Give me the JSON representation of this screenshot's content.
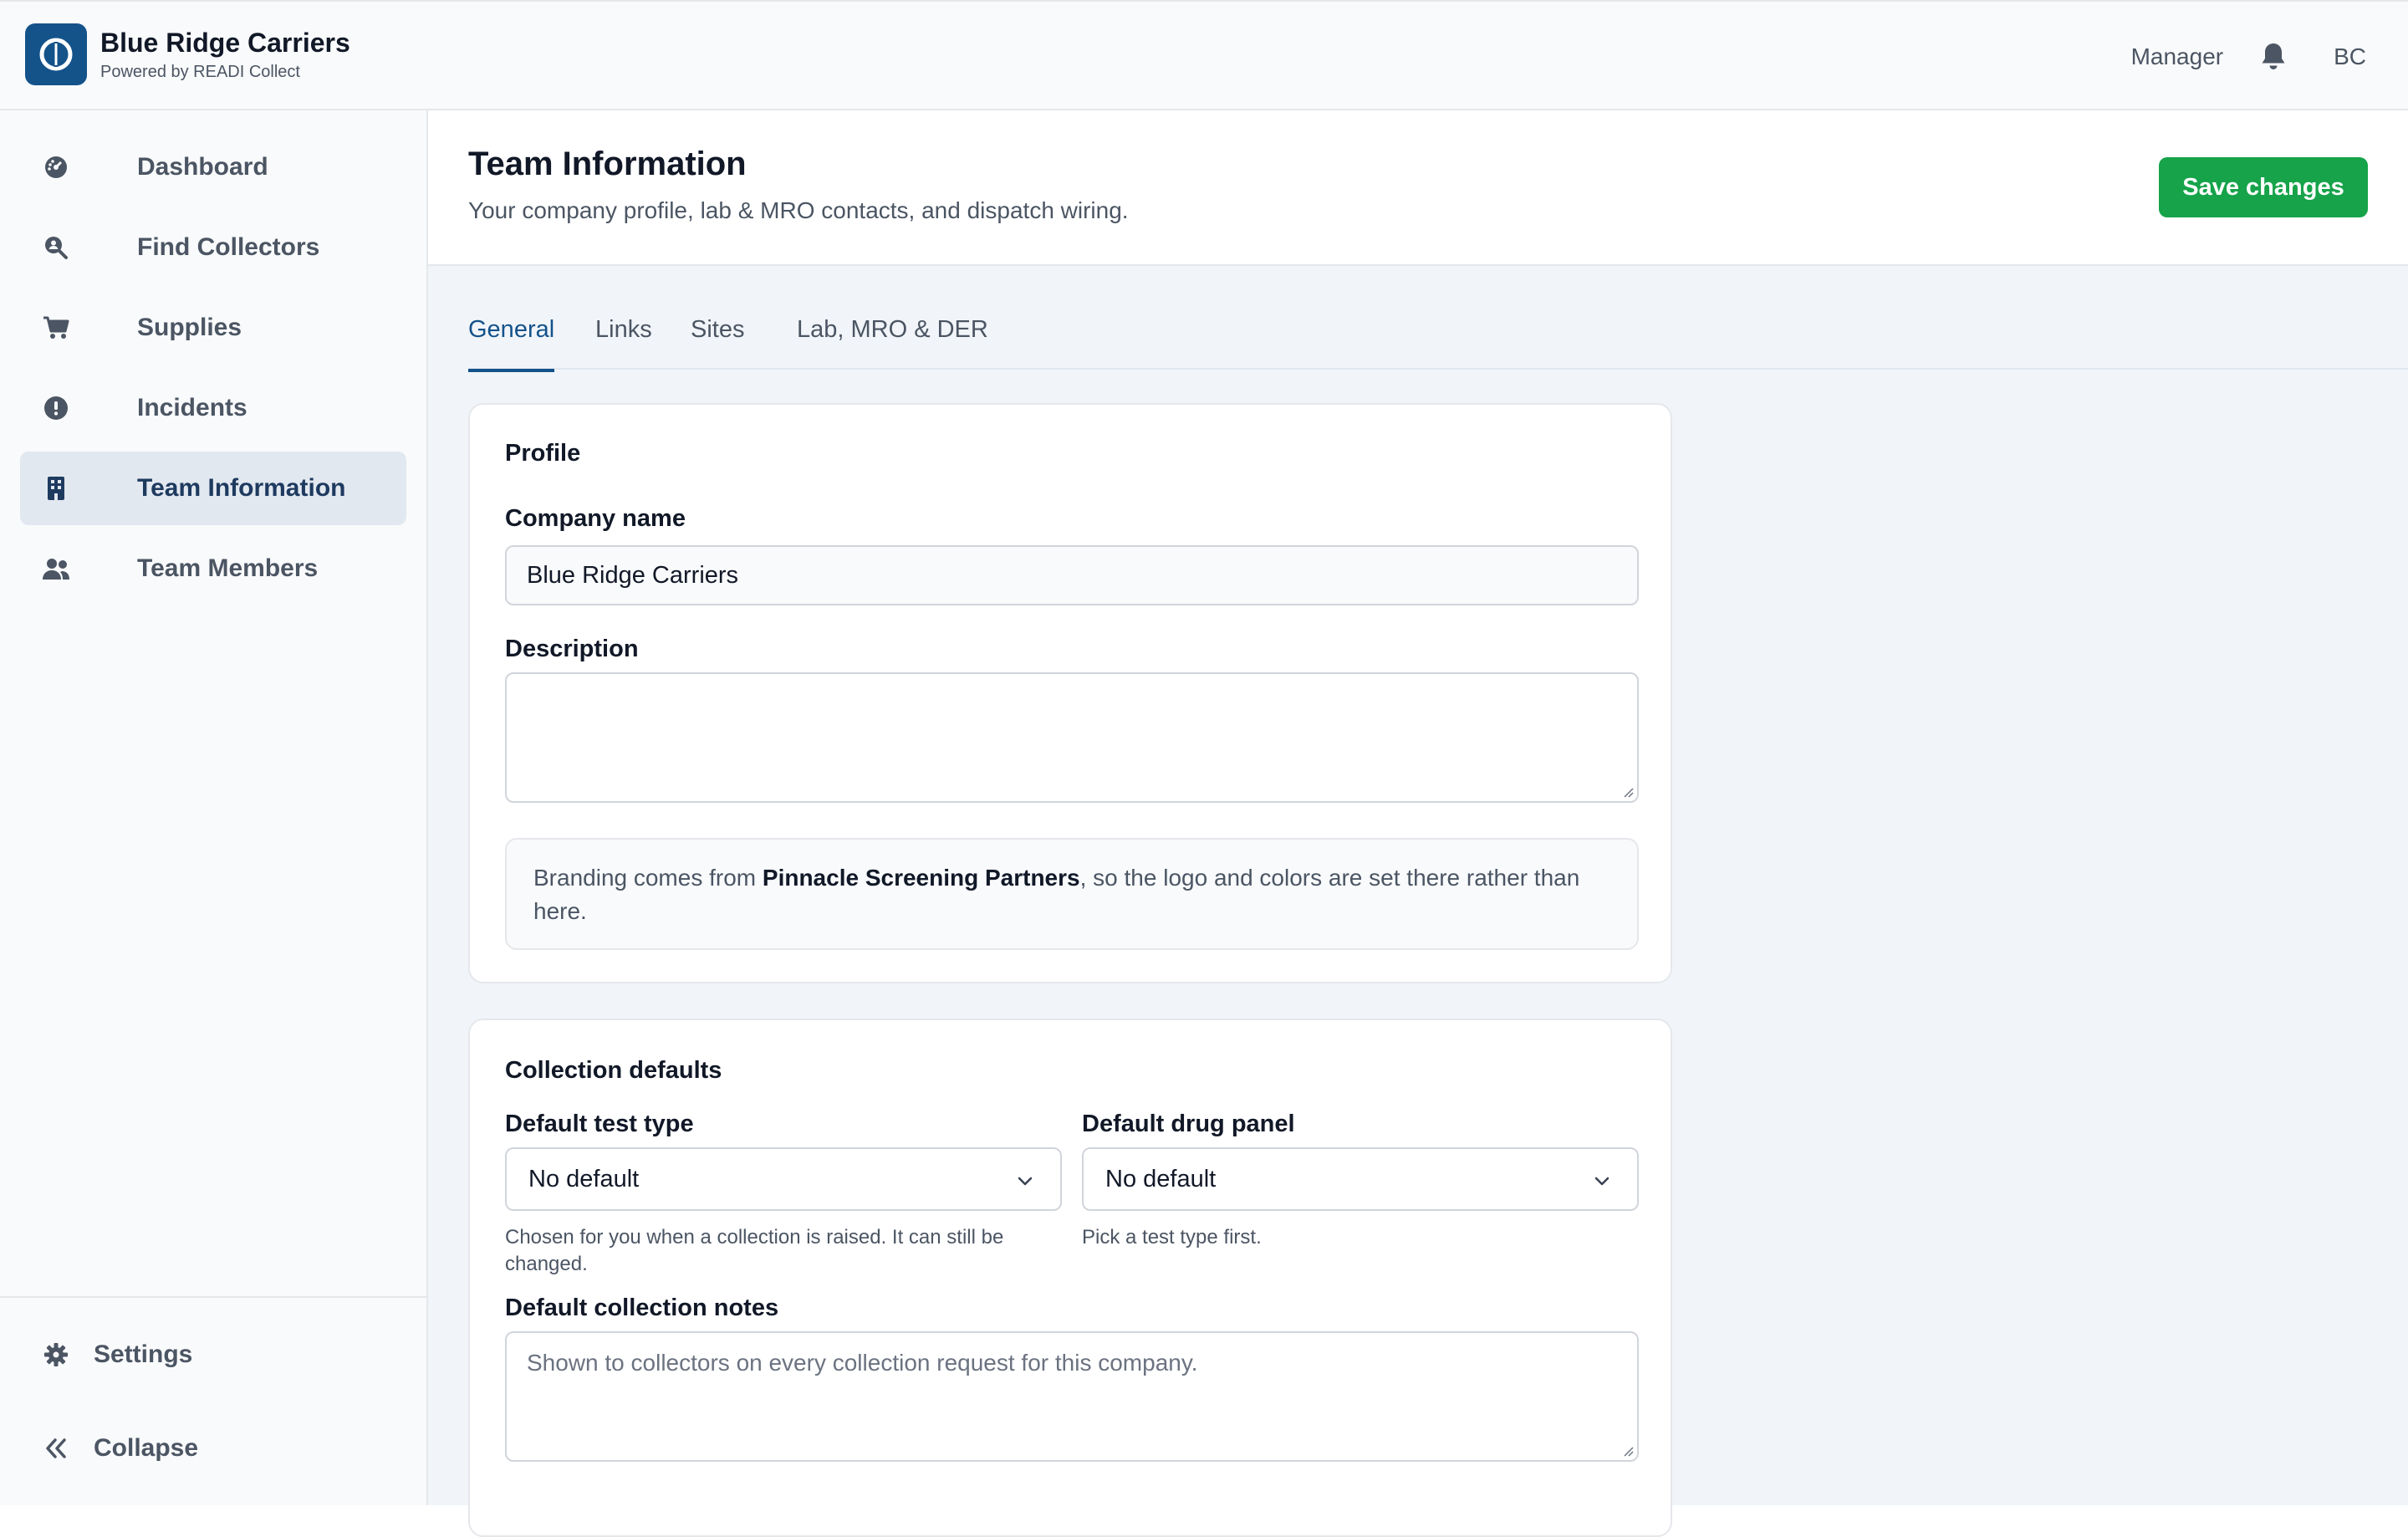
{
  "brand": {
    "title": "Blue Ridge Carriers",
    "subtitle": "Powered by READI Collect",
    "logo_icon": "readi-logo-icon",
    "color": "#14528a"
  },
  "topbar": {
    "role": "Manager",
    "bell_icon": "bell-icon",
    "initials": "BC"
  },
  "sidebar": {
    "items": [
      {
        "label": "Dashboard",
        "icon": "dashboard-gauge-icon"
      },
      {
        "label": "Find Collectors",
        "icon": "search-person-icon"
      },
      {
        "label": "Supplies",
        "icon": "cart-icon"
      },
      {
        "label": "Incidents",
        "icon": "alert-circle-icon"
      },
      {
        "label": "Team Information",
        "icon": "building-icon",
        "active": true
      },
      {
        "label": "Team Members",
        "icon": "users-icon"
      }
    ],
    "settings_label": "Settings",
    "collapse_label": "Collapse"
  },
  "header": {
    "title": "Team Information",
    "subtitle": "Your company profile, lab & MRO contacts, and dispatch wiring.",
    "save_label": "Save changes",
    "save_color": "#16a34a"
  },
  "tabs": [
    {
      "label": "General",
      "active": true
    },
    {
      "label": "Links"
    },
    {
      "label": "Sites"
    },
    {
      "label": "Lab, MRO & DER"
    }
  ],
  "profile": {
    "title": "Profile",
    "company_name_label": "Company name",
    "company_name_value": "Blue Ridge Carriers",
    "description_label": "Description",
    "description_value": "",
    "branding_note_prefix": "Branding comes from ",
    "branding_note_partner": "Pinnacle Screening Partners",
    "branding_note_suffix": ", so the logo and colors are set there rather than here."
  },
  "collection_defaults": {
    "title": "Collection defaults",
    "test_type_label": "Default test type",
    "test_type_value": "No default",
    "test_type_hint": "Chosen for you when a collection is raised. It can still be changed.",
    "drug_panel_label": "Default drug panel",
    "drug_panel_value": "No default",
    "drug_panel_hint": "Pick a test type first.",
    "notes_label": "Default collection notes",
    "notes_placeholder": "Shown to collectors on every collection request for this company."
  }
}
